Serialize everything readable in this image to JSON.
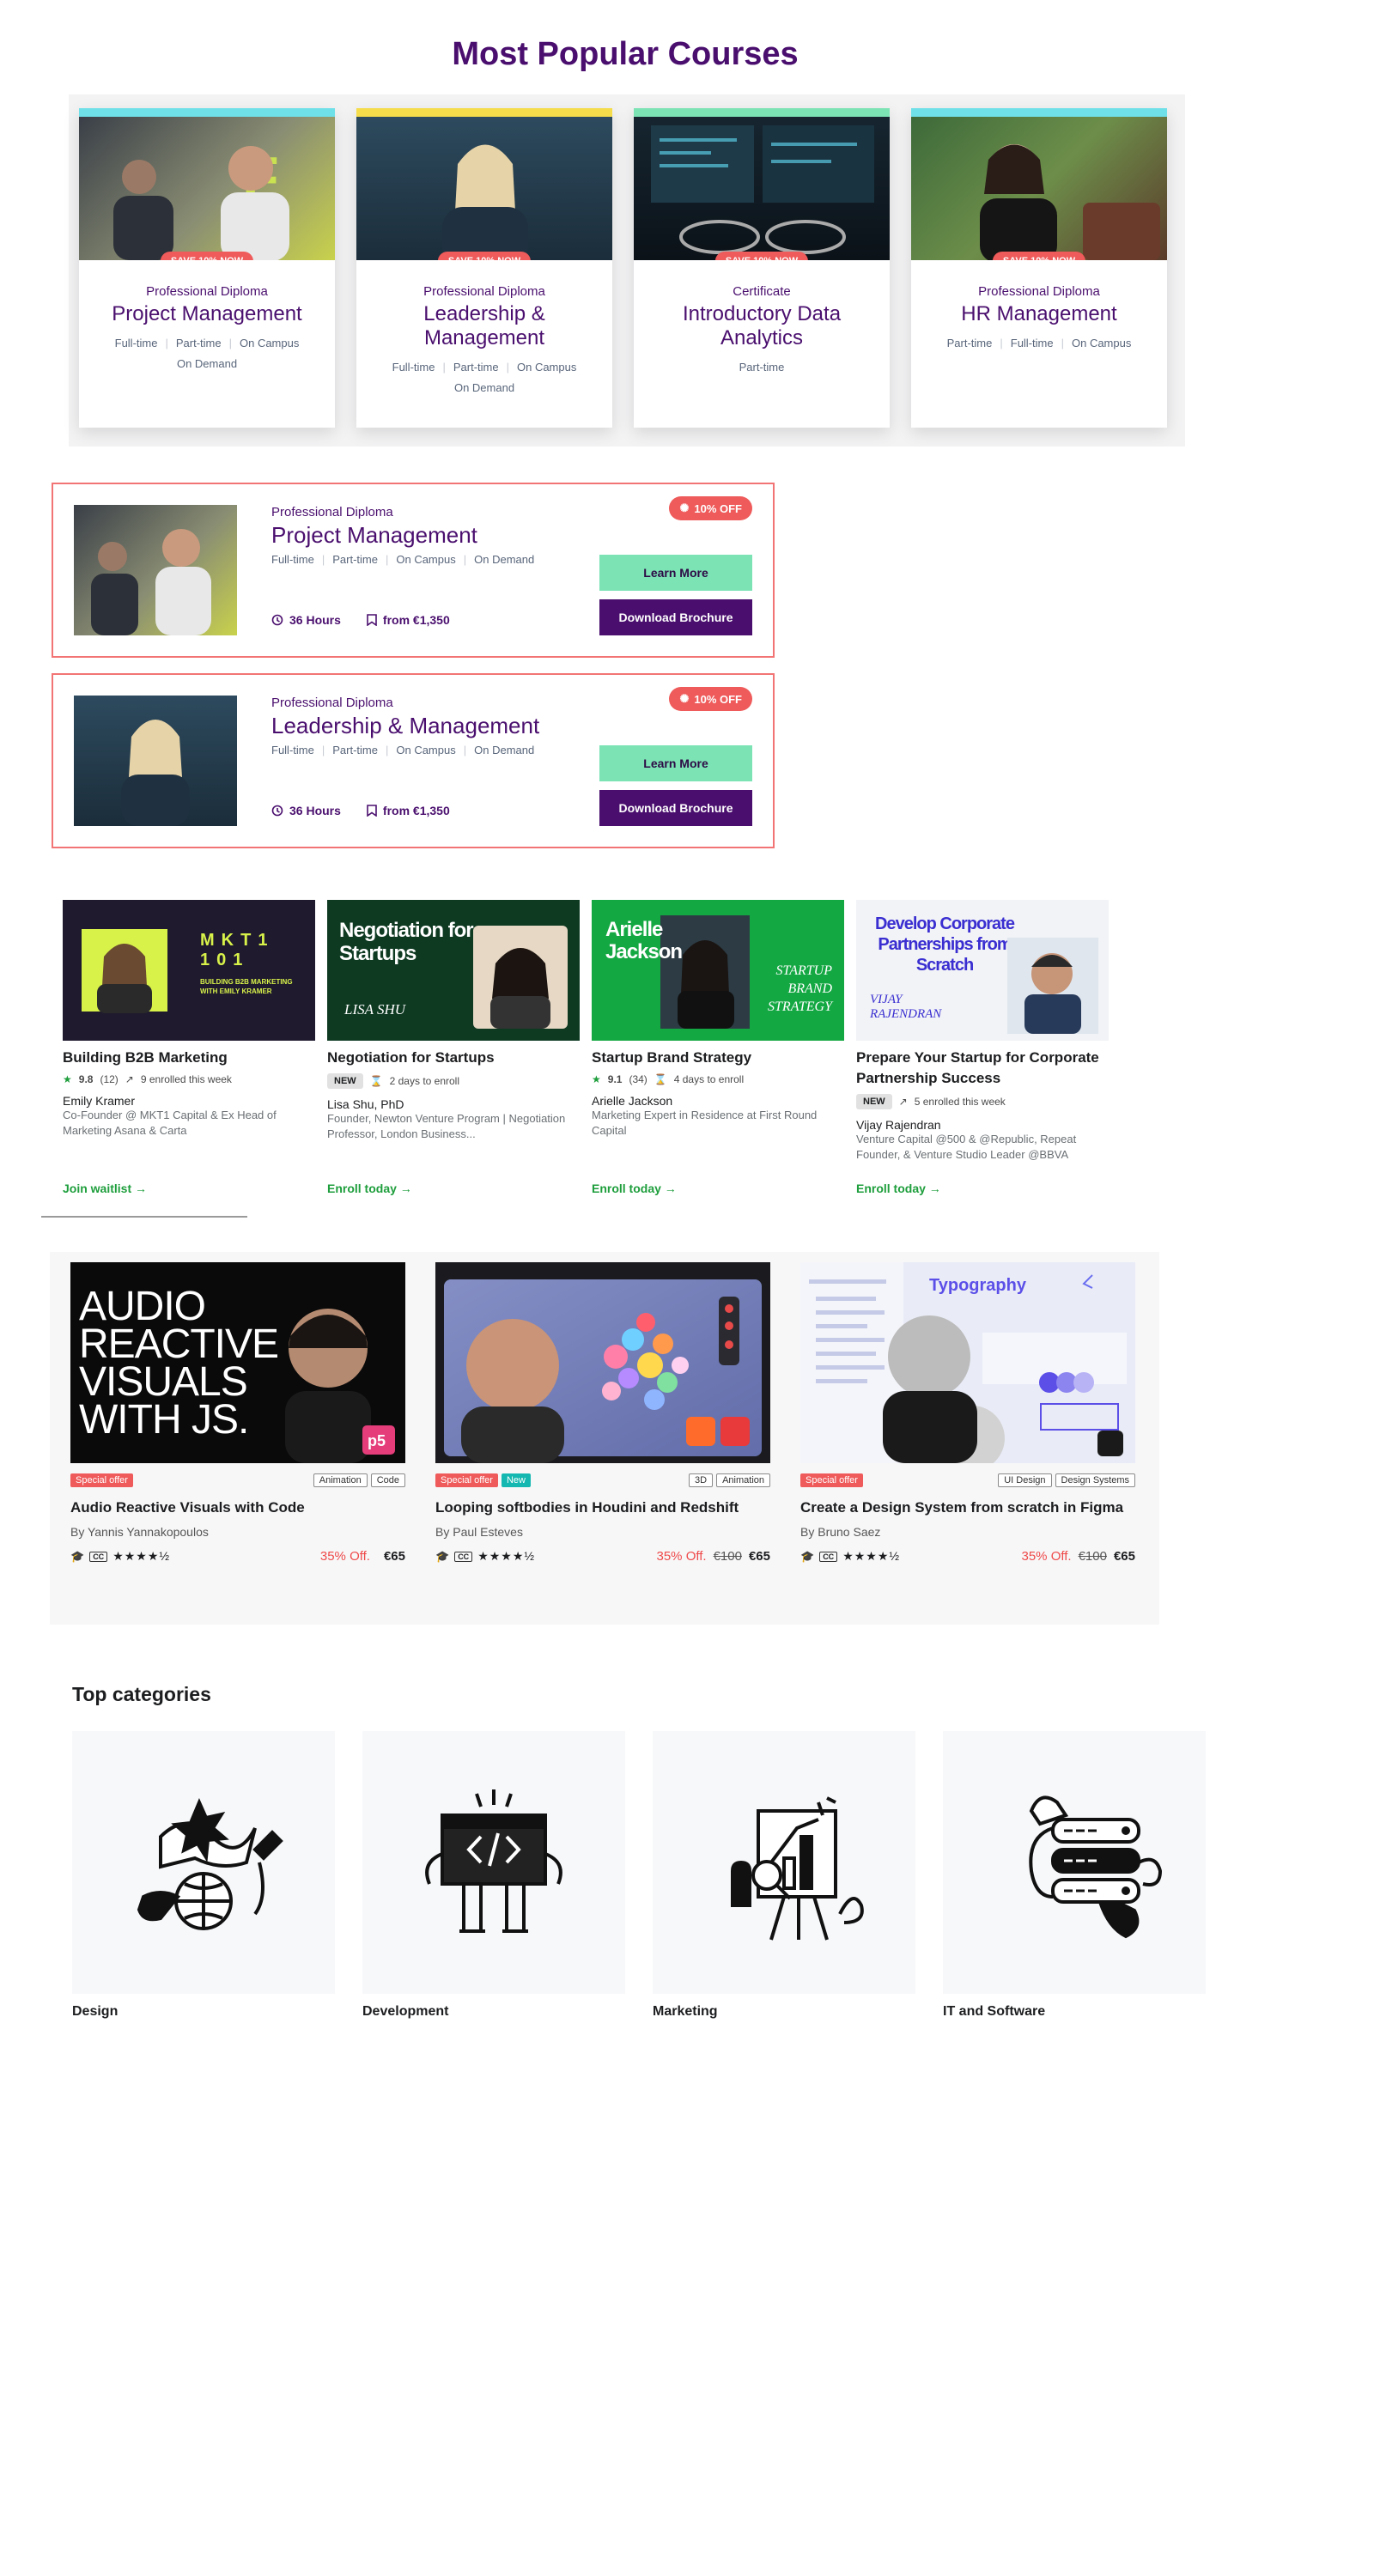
{
  "popular": {
    "title": "Most Popular Courses",
    "cards": [
      {
        "badge": "SAVE 10% NOW",
        "type": "Professional Diploma",
        "name": "Project Management",
        "modes": [
          "Full-time",
          "Part-time",
          "On Campus",
          "On Demand"
        ],
        "bar_color": "#6fe0e8"
      },
      {
        "badge": "SAVE 10% NOW",
        "type": "Professional Diploma",
        "name": "Leadership & Management",
        "modes": [
          "Full-time",
          "Part-time",
          "On Campus",
          "On Demand"
        ],
        "bar_color": "#f5dc4a"
      },
      {
        "badge": "SAVE 10% NOW",
        "type": "Certificate",
        "name": "Introductory Data Analytics",
        "modes": [
          "Part-time"
        ],
        "bar_color": "#7ce3b5"
      },
      {
        "badge": "SAVE 10% NOW",
        "type": "Professional Diploma",
        "name": "HR Management",
        "modes": [
          "Part-time",
          "Full-time",
          "On Campus"
        ],
        "bar_color": "#6fe0e8"
      }
    ]
  },
  "list": [
    {
      "type": "Professional Diploma",
      "name": "Project Management",
      "modes": [
        "Full-time",
        "Part-time",
        "On Campus",
        "On Demand"
      ],
      "off": "10% OFF",
      "hours": "36 Hours",
      "price": "from €1,350",
      "learn": "Learn More",
      "brochure": "Download Brochure"
    },
    {
      "type": "Professional Diploma",
      "name": "Leadership & Management",
      "modes": [
        "Full-time",
        "Part-time",
        "On Campus",
        "On Demand"
      ],
      "off": "10% OFF",
      "hours": "36 Hours",
      "price": "from €1,350",
      "learn": "Learn More",
      "brochure": "Download Brochure"
    }
  ],
  "masterclasses": [
    {
      "title": "Building B2B Marketing",
      "rating": "9.8",
      "count": "(12)",
      "activity": "9 enrolled this week",
      "instructor": "Emily Kramer",
      "desc": "Co-Founder @ MKT1 Capital & Ex Head of Marketing Asana & Carta",
      "cta": "Join waitlist →",
      "img_text": "MKT1 101",
      "img_sub": "BUILDING B2B MARKETING WITH EMILY KRAMER"
    },
    {
      "title": "Negotiation for Startups",
      "badge": "NEW",
      "activity": "2 days to enroll",
      "instructor": "Lisa Shu, PhD",
      "desc": "Founder, Newton Venture Program | Negotiation Professor, London Business...",
      "cta": "Enroll today →",
      "img_text": "Negotiation for Startups",
      "img_sub": "LISA SHU"
    },
    {
      "title": "Startup Brand Strategy",
      "rating": "9.1",
      "count": "(34)",
      "activity": "4 days to enroll",
      "instructor": "Arielle Jackson",
      "desc": "Marketing Expert in Residence at First Round Capital",
      "cta": "Enroll today →",
      "img_text": "Arielle Jackson",
      "img_sub": "STARTUP BRAND STRATEGY"
    },
    {
      "title": "Prepare Your Startup for Corporate Partnership Success",
      "badge": "NEW",
      "activity": "5 enrolled this week",
      "instructor": "Vijay Rajendran",
      "desc": "Venture Capital @500 & @Republic, Repeat Founder, & Venture Studio Leader @BBVA",
      "cta": "Enroll today →",
      "img_text": "Develop Corporate Partnerships from Scratch",
      "img_sub": "VIJAY RAJENDRAN"
    }
  ],
  "design_courses": [
    {
      "tags_left": [
        "Special offer"
      ],
      "tags_right": [
        "Animation",
        "Code"
      ],
      "title": "Audio Reactive Visuals with Code",
      "by": "By Yannis Yannakopoulos",
      "discount": "35% Off.",
      "old": "",
      "price": "€65",
      "img_text": "AUDIO REACTIVE VISUALS WITH JS.",
      "stars": "★★★★½"
    },
    {
      "tags_left": [
        "Special offer",
        "New"
      ],
      "tags_right": [
        "3D",
        "Animation"
      ],
      "title": "Looping softbodies in Houdini and Redshift",
      "by": "By Paul Esteves",
      "discount": "35% Off.",
      "old": "€100",
      "price": "€65",
      "stars": "★★★★½"
    },
    {
      "tags_left": [
        "Special offer"
      ],
      "tags_right": [
        "UI Design",
        "Design Systems"
      ],
      "title": "Create a Design System from scratch in Figma",
      "by": "By Bruno Saez",
      "discount": "35% Off.",
      "old": "€100",
      "price": "€65",
      "img_text": "Typography",
      "stars": "★★★★½"
    }
  ],
  "categories": {
    "title": "Top categories",
    "items": [
      {
        "label": "Design",
        "icon": "design-illustration"
      },
      {
        "label": "Development",
        "icon": "development-illustration"
      },
      {
        "label": "Marketing",
        "icon": "marketing-illustration"
      },
      {
        "label": "IT and Software",
        "icon": "it-software-illustration"
      }
    ]
  },
  "colors": {
    "brand_purple": "#4a0f6e",
    "mint": "#7ce3b5",
    "offer_red": "#ef5a5a",
    "green": "#1e9e3c"
  }
}
